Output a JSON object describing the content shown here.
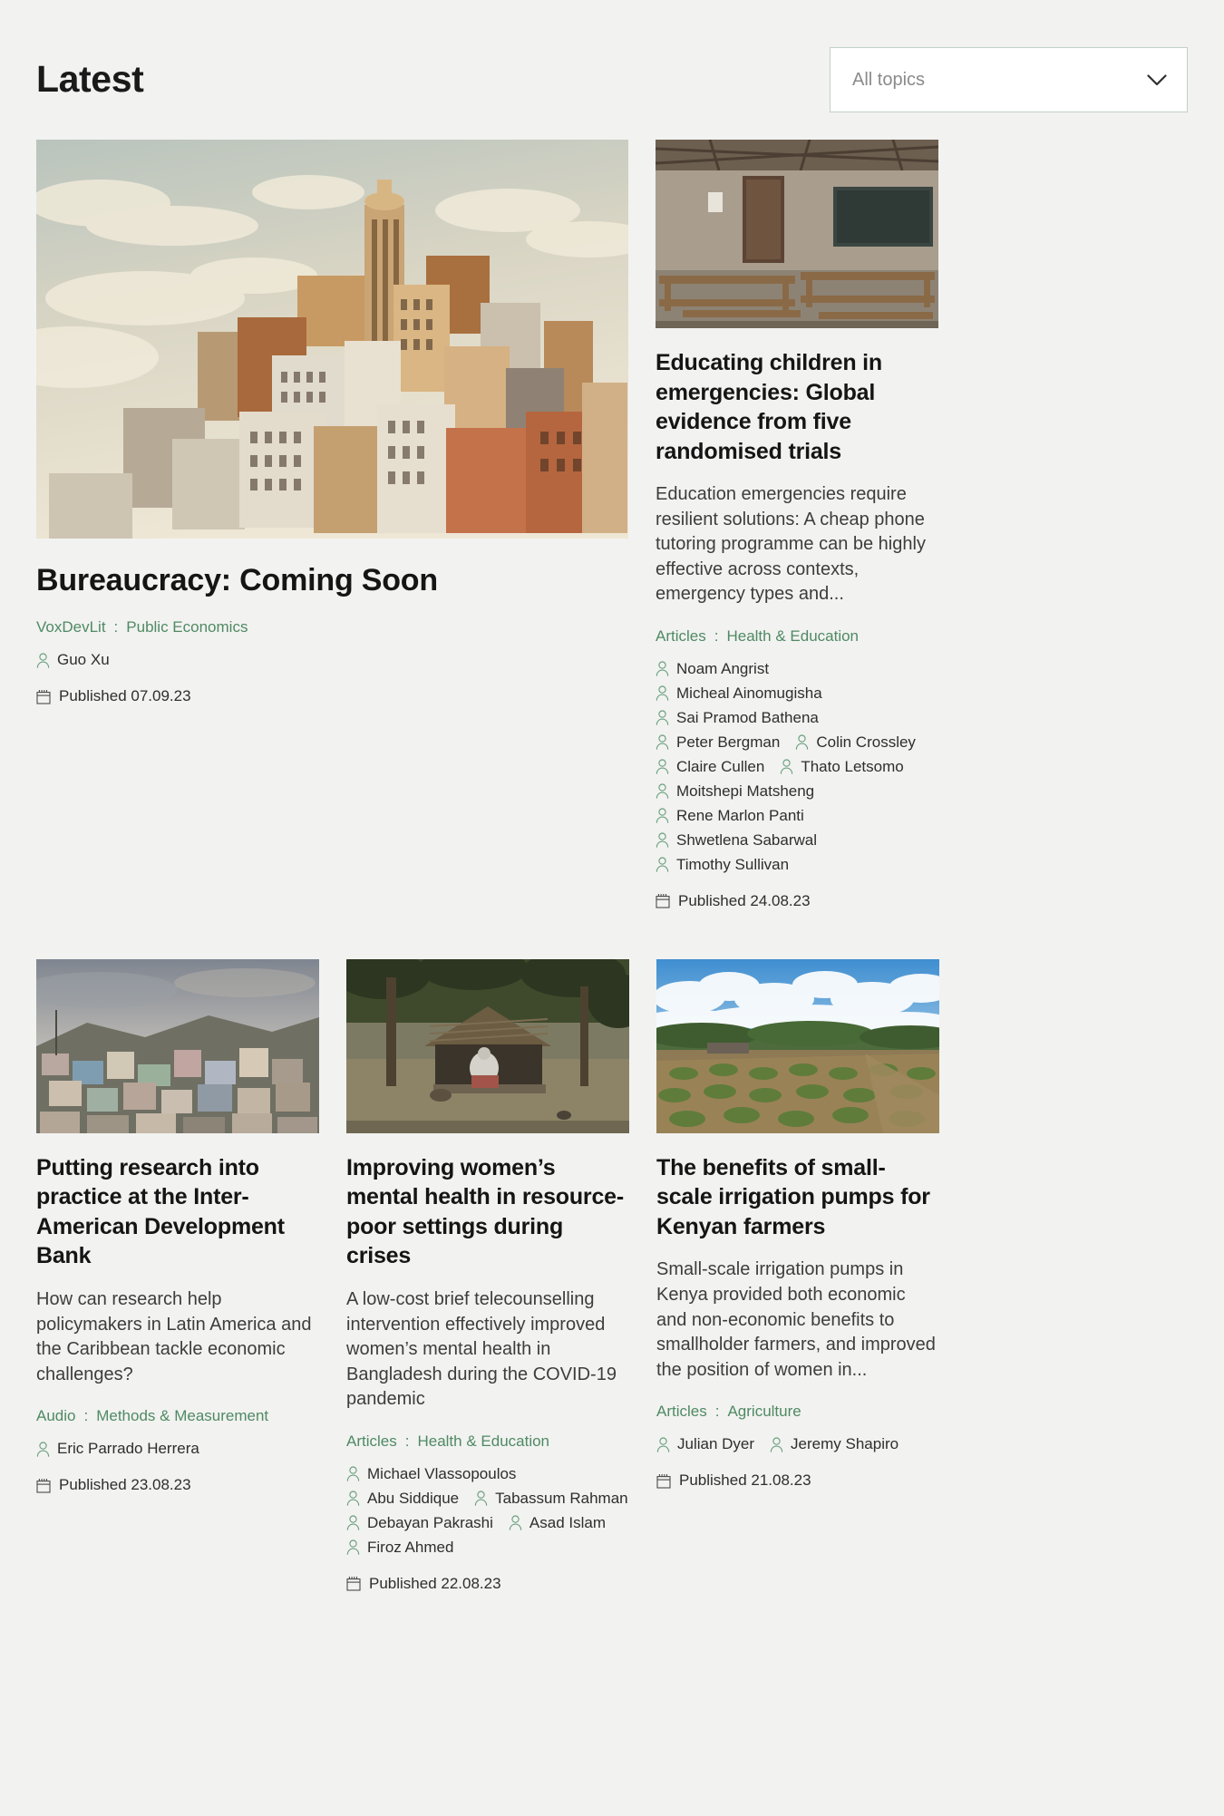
{
  "header": {
    "title": "Latest",
    "topic_filter": {
      "value": "All topics",
      "icon": "chevron-down-icon"
    }
  },
  "labels": {
    "published_prefix": "Published",
    "taxonomy_separator": ":",
    "author_icon": "person-icon",
    "date_icon": "calendar-icon"
  },
  "colors": {
    "page_background": "#f2f2f1",
    "accent_green": "#4f8a63",
    "title_text": "#151515",
    "body_text": "#3d3d3d",
    "select_border": "#c2d0c4",
    "select_background": "#ffffff",
    "placeholder_text": "#8a8a8a"
  },
  "featured": {
    "title": "Bureaucracy: Coming Soon",
    "image_alt": "Illustration of a dense hill of stacked beige and terracotta buildings under a pale cloudy sky",
    "taxonomy": {
      "type": "VoxDevLit",
      "topic": "Public Economics"
    },
    "authors": [
      "Guo Xu"
    ],
    "published": "Published 07.09.23"
  },
  "side_article": {
    "title": "Educating children in emergencies: Global evidence from five randomised trials",
    "image_alt": "Empty rural classroom with wooden desks, benches and a blackboard",
    "excerpt": "Education emergencies require resilient solutions: A cheap phone tutoring programme can be highly effective across contexts, emergency types and...",
    "taxonomy": {
      "type": "Articles",
      "topic": "Health & Education"
    },
    "authors": [
      "Noam Angrist",
      "Micheal Ainomugisha",
      "Sai Pramod Bathena",
      "Peter Bergman",
      "Colin Crossley",
      "Claire Cullen",
      "Thato Letsomo",
      "Moitshepi Matsheng",
      "Rene Marlon Panti",
      "Shwetlena Sabarwal",
      "Timothy Sullivan"
    ],
    "published": "Published 24.08.23"
  },
  "bottom_articles": [
    {
      "title": "Putting research into practice at the Inter-American Development Bank",
      "image_alt": "Hillside of densely packed colourful informal housing under a cloudy sky",
      "excerpt": "How can research help policymakers in Latin America and the Caribbean tackle economic challenges?",
      "taxonomy": {
        "type": "Audio",
        "topic": "Methods & Measurement"
      },
      "authors": [
        "Eric Parrado Herrera"
      ],
      "published": "Published 23.08.23"
    },
    {
      "title": "Improving women’s mental health in resource-poor settings during crises",
      "image_alt": "Woman seated beneath a thatched shelter in a rural yard with trees",
      "excerpt": "A low-cost brief telecounselling intervention effectively improved women’s mental health in Bangladesh during the COVID-19 pandemic",
      "taxonomy": {
        "type": "Articles",
        "topic": "Health & Education"
      },
      "authors": [
        "Michael Vlassopoulos",
        "Abu Siddique",
        "Tabassum Rahman",
        "Debayan Pakrashi",
        "Asad Islam",
        "Firoz Ahmed"
      ],
      "published": "Published 22.08.23"
    },
    {
      "title": "The benefits of small-scale irrigation pumps for Kenyan farmers",
      "image_alt": "Green crop rows in a cultivated field under a blue sky with cumulus clouds",
      "excerpt": "Small-scale irrigation pumps in Kenya provided both economic and non-economic benefits to smallholder farmers, and improved the position of women in...",
      "taxonomy": {
        "type": "Articles",
        "topic": "Agriculture"
      },
      "authors": [
        "Julian Dyer",
        "Jeremy Shapiro"
      ],
      "published": "Published 21.08.23"
    }
  ]
}
